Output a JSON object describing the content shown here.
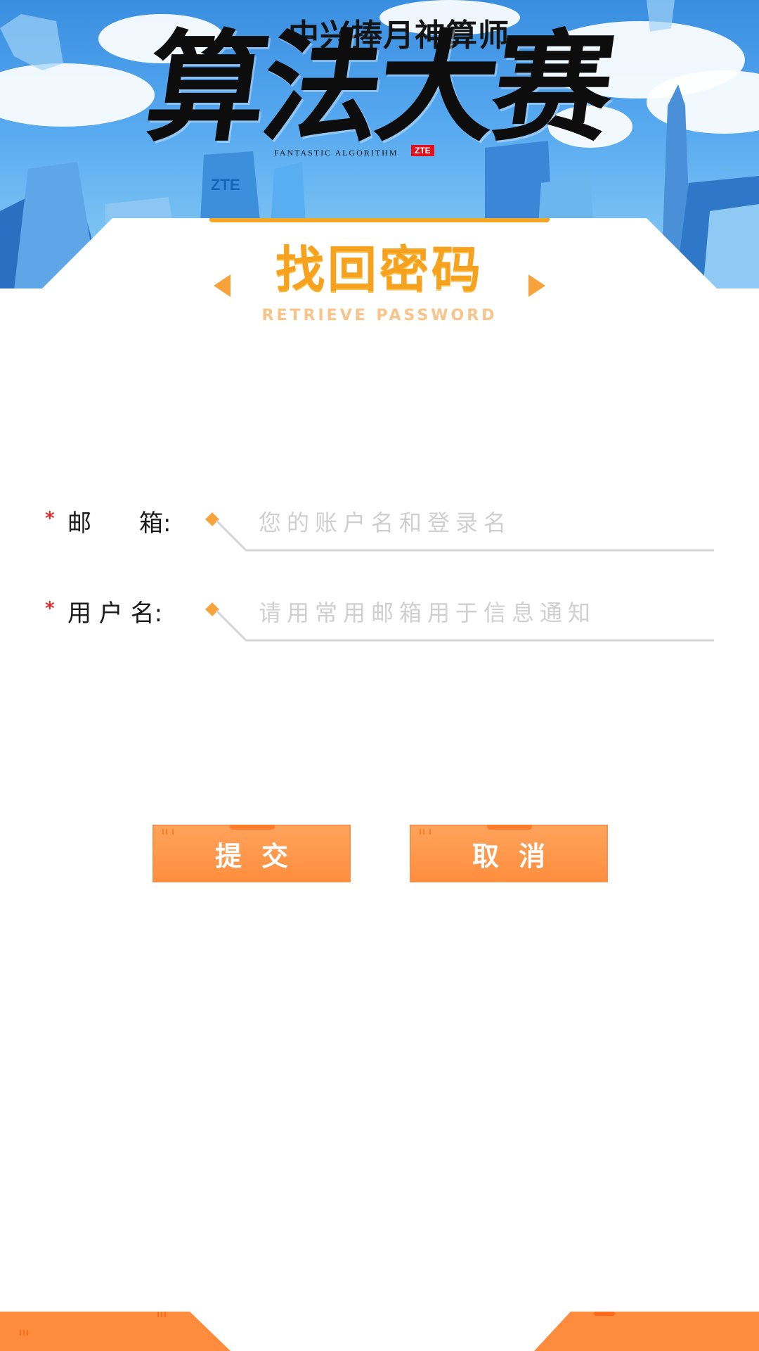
{
  "banner": {
    "title_small": "中兴捧月神算师",
    "title_big": "算法大赛",
    "title_sub": "FANTASTIC ALGORITHM",
    "badge": "ZTE",
    "building_text": "ZTE"
  },
  "header": {
    "title": "找回密码",
    "subtitle": "RETRIEVE PASSWORD"
  },
  "form": {
    "email": {
      "required_mark": "*",
      "label": "邮　　箱:",
      "placeholder": "您的账户名和登录名",
      "value": ""
    },
    "username": {
      "required_mark": "*",
      "label": "用 户 名:",
      "placeholder": "请用常用邮箱用于信息通知",
      "value": ""
    }
  },
  "buttons": {
    "submit": "提交",
    "cancel": "取消"
  },
  "colors": {
    "accent": "#f7a21e",
    "button": "#ff8e3f",
    "required": "#e52a2a",
    "placeholder": "#cfcfcf"
  }
}
